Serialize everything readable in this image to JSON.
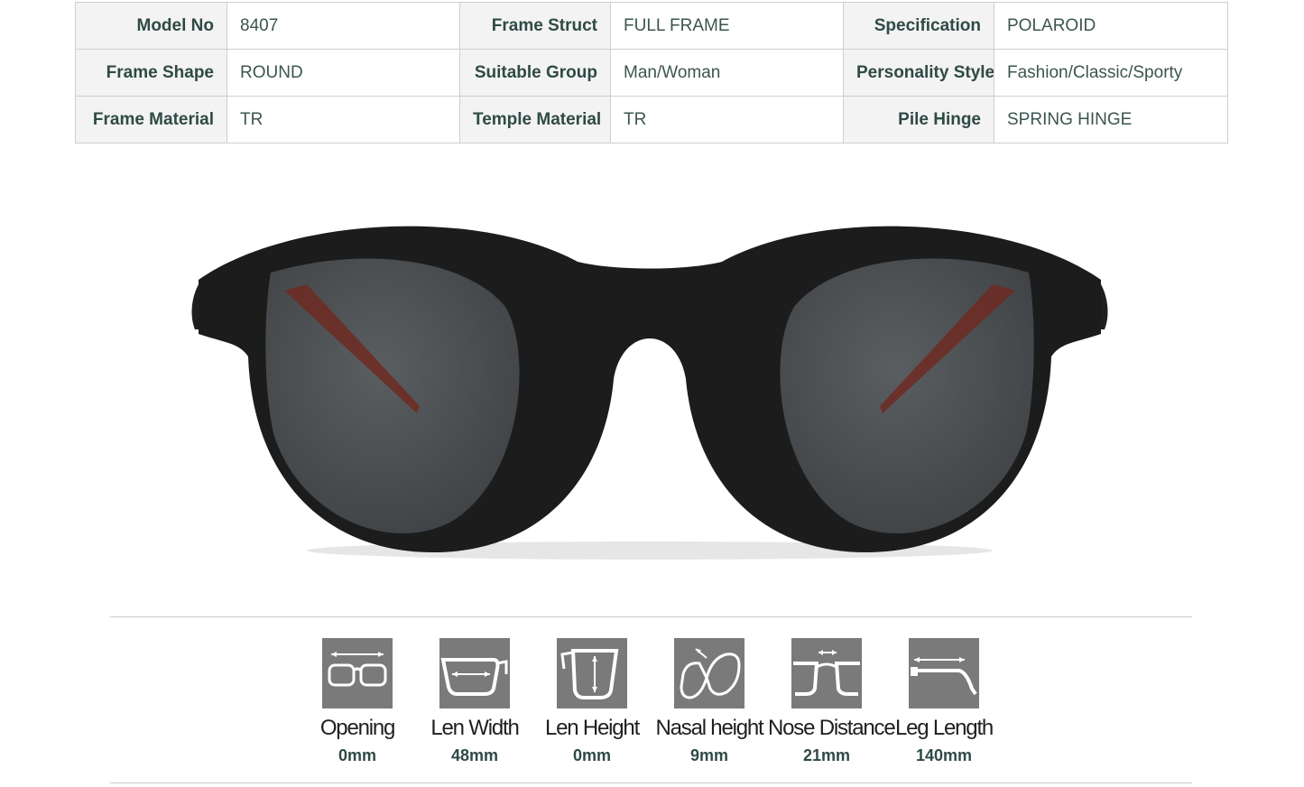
{
  "specs": {
    "rows": [
      [
        {
          "label": "Model No",
          "value": "8407"
        },
        {
          "label": "Frame Struct",
          "value": "FULL FRAME"
        },
        {
          "label": "Specification",
          "value": "POLAROID"
        }
      ],
      [
        {
          "label": "Frame Shape",
          "value": "ROUND"
        },
        {
          "label": "Suitable Group",
          "value": "Man/Woman"
        },
        {
          "label": "Personality Style",
          "value": "Fashion/Classic/Sporty"
        }
      ],
      [
        {
          "label": "Frame Material",
          "value": "TR"
        },
        {
          "label": "Temple Material",
          "value": "TR"
        },
        {
          "label": "Pile Hinge",
          "value": "SPRING HINGE"
        }
      ]
    ]
  },
  "product_image": {
    "icon": "round-sunglasses-illustration",
    "frame_color": "#1c1c1c",
    "lens_color": "#4b4f52",
    "temple_accent_color": "#6e2a22"
  },
  "measurements": [
    {
      "label": "Opening",
      "value": "0mm",
      "icon": "opening-icon"
    },
    {
      "label": "Len Width",
      "value": "48mm",
      "icon": "lens-width-icon"
    },
    {
      "label": "Len Height",
      "value": "0mm",
      "icon": "lens-height-icon"
    },
    {
      "label": "Nasal height",
      "value": "9mm",
      "icon": "nasal-height-icon"
    },
    {
      "label": "Nose Distance",
      "value": "21mm",
      "icon": "nose-distance-icon"
    },
    {
      "label": "Leg Length",
      "value": "140mm",
      "icon": "leg-length-icon"
    }
  ],
  "colors": {
    "label_text": "#2f4a45",
    "tile_gray": "#7a7a7a"
  }
}
